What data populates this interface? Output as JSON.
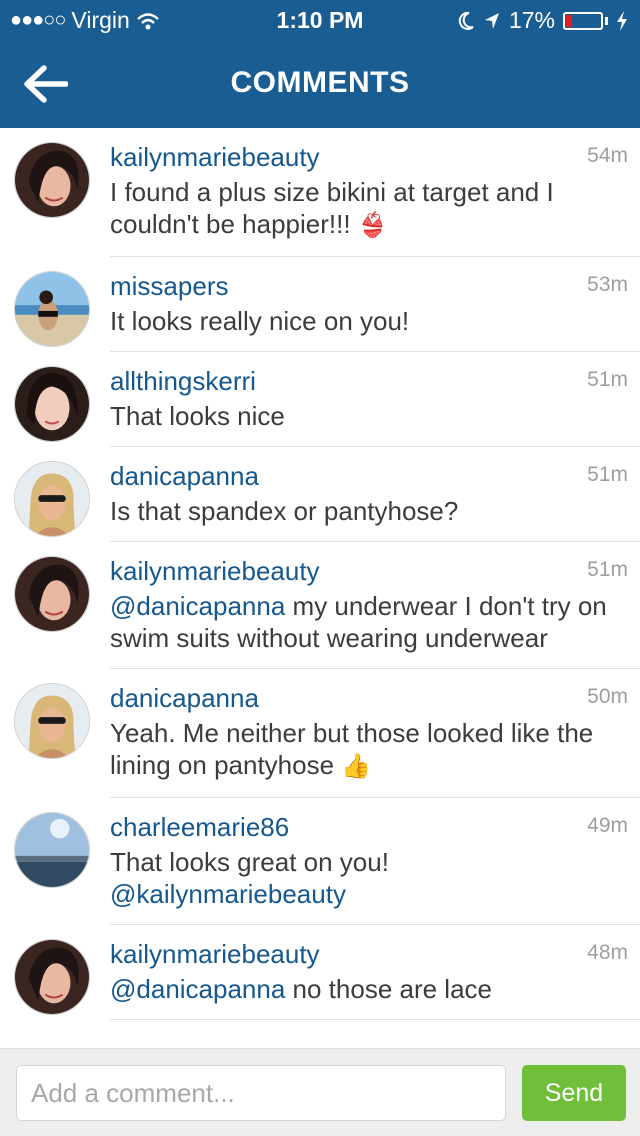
{
  "status_bar": {
    "carrier": "Virgin",
    "time": "1:10 PM",
    "battery": "17%",
    "battery_level": 0.17
  },
  "header": {
    "title": "COMMENTS",
    "back_icon": "arrow-left-icon",
    "background": "#1a5d93"
  },
  "comments": [
    {
      "username": "kailynmariebeauty",
      "time": "54m",
      "text": "I found a plus size bikini at target and I couldn't be happier!!! ",
      "emoji": "👙",
      "mention": ""
    },
    {
      "username": "missapers",
      "time": "53m",
      "text": "It looks really nice on you!",
      "emoji": "",
      "mention": ""
    },
    {
      "username": "allthingskerri",
      "time": "51m",
      "text": "That looks nice",
      "emoji": "",
      "mention": ""
    },
    {
      "username": "danicapanna",
      "time": "51m",
      "text": "Is that spandex or pantyhose?",
      "emoji": "",
      "mention": ""
    },
    {
      "username": "kailynmariebeauty",
      "time": "51m",
      "mention": "@danicapanna",
      "text": " my underwear I don't try on swim suits without wearing underwear",
      "emoji": ""
    },
    {
      "username": "danicapanna",
      "time": "50m",
      "text": "Yeah. Me neither but those looked like the lining on pantyhose ",
      "emoji": "👍",
      "mention": ""
    },
    {
      "username": "charleemarie86",
      "time": "49m",
      "text": "That looks great on you! ",
      "mention_after": "@kailynmariebeauty",
      "emoji": "",
      "mention": ""
    },
    {
      "username": "kailynmariebeauty",
      "time": "48m",
      "mention": "@danicapanna",
      "text": " no those are lace",
      "emoji": ""
    }
  ],
  "footer": {
    "placeholder": "Add a comment...",
    "send_label": "Send",
    "send_color": "#6fbf3a"
  }
}
